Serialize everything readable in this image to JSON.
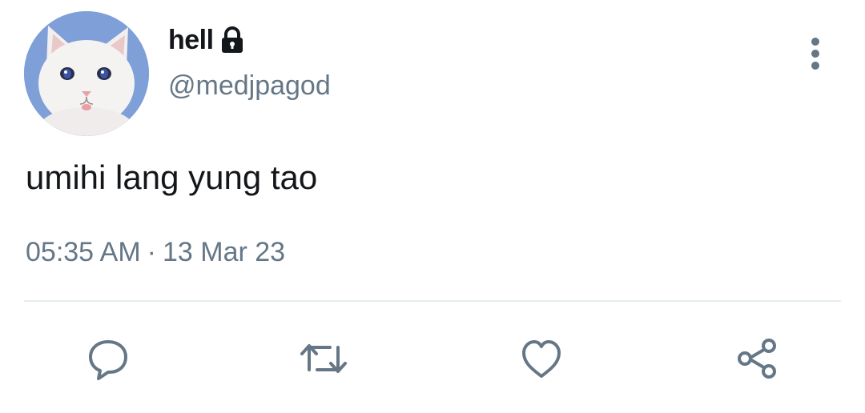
{
  "tweet": {
    "display_name": "hell",
    "handle": "@medjpagod",
    "text": "umihi lang yung tao",
    "time": "05:35 AM",
    "separator": "·",
    "date": "13 Mar 23",
    "protected": true,
    "avatar": "white-cat-photo"
  },
  "icons": {
    "lock": "lock-icon",
    "more": "vertical-ellipsis-icon",
    "reply": "reply-bubble-icon",
    "retweet": "retweet-icon",
    "like": "heart-icon",
    "share": "share-icon"
  },
  "colors": {
    "text_primary": "#14171a",
    "text_secondary": "#657786",
    "divider": "#e6ecf0",
    "icon": "#657786",
    "avatar_bg": "#7f9fd8"
  }
}
